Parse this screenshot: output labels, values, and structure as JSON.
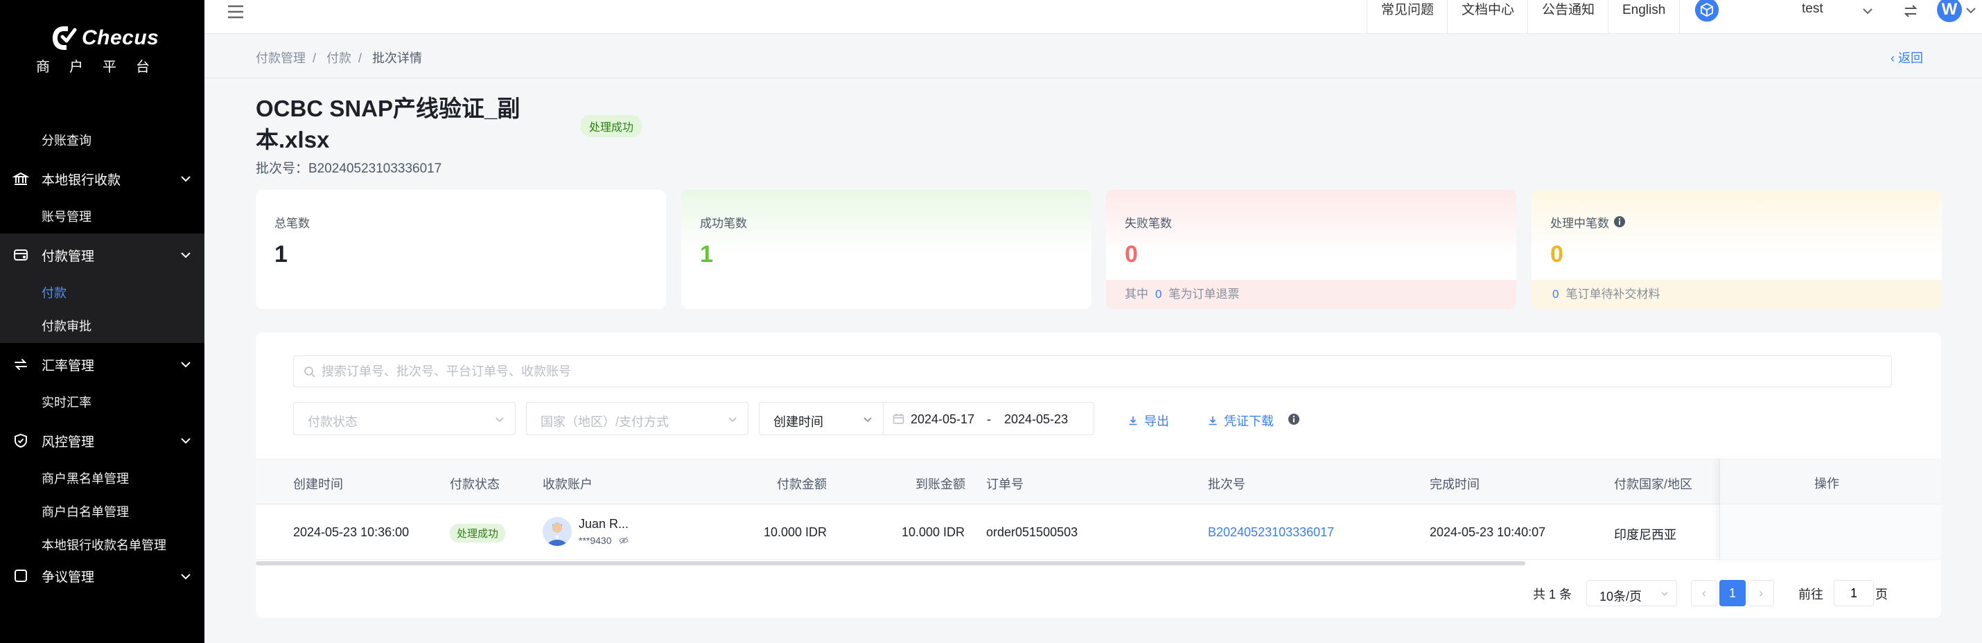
{
  "sidebar": {
    "logo_text": "Checus",
    "logo_sub": "商户平台",
    "partial_item": "",
    "items_top": [
      {
        "label": "分账查询"
      }
    ],
    "groups": [
      {
        "label": "本地银行收款",
        "icon": "bank-icon",
        "items": [
          {
            "label": "账号管理"
          }
        ]
      },
      {
        "label": "付款管理",
        "icon": "payment-icon",
        "items": [
          {
            "label": "付款",
            "active": true
          },
          {
            "label": "付款审批"
          }
        ]
      },
      {
        "label": "汇率管理",
        "icon": "exchange-icon",
        "items": [
          {
            "label": "实时汇率"
          }
        ]
      },
      {
        "label": "风控管理",
        "icon": "shield-icon",
        "items": [
          {
            "label": "商户黑名单管理"
          },
          {
            "label": "商户白名单管理"
          },
          {
            "label": "本地银行收款名单管理"
          }
        ]
      },
      {
        "label": "争议管理",
        "icon": "dispute-icon",
        "items": []
      }
    ]
  },
  "topbar": {
    "links": [
      "常见问题",
      "文档中心",
      "公告通知",
      "English"
    ],
    "user": "test",
    "avatar_letter": "W"
  },
  "breadcrumb": [
    "付款管理",
    "付款",
    "批次详情"
  ],
  "back_label": "返回",
  "page": {
    "title": "OCBC SNAP产线验证_副本.xlsx",
    "status": "处理成功",
    "batch_label": "批次号：B20240523103336017"
  },
  "stats": {
    "total": {
      "label": "总笔数",
      "value": "1"
    },
    "success": {
      "label": "成功笔数",
      "value": "1",
      "color": "#67c23a"
    },
    "fail": {
      "label": "失败笔数",
      "value": "0",
      "color": "#f56c6c",
      "foot_prefix": "其中",
      "foot_count": "0",
      "foot_suffix": "笔为订单退票"
    },
    "pending": {
      "label": "处理中笔数",
      "value": "0",
      "color": "#f0b429",
      "foot_count": "0",
      "foot_suffix": "笔订单待补交材料"
    }
  },
  "filters": {
    "search_placeholder": "搜索订单号、批次号、平台订单号、收款账号",
    "status_placeholder": "付款状态",
    "country_placeholder": "国家（地区）/支付方式",
    "time_type": "创建时间",
    "date_start": "2024-05-17",
    "date_sep": "-",
    "date_end": "2024-05-23",
    "export_label": "导出",
    "voucher_label": "凭证下载"
  },
  "table": {
    "headers": [
      "创建时间",
      "付款状态",
      "收款账户",
      "付款金额",
      "到账金额",
      "订单号",
      "批次号",
      "完成时间",
      "付款国家/地区",
      "操作"
    ],
    "rows": [
      {
        "created": "2024-05-23 10:36:00",
        "status": "处理成功",
        "payee_name": "Juan R...",
        "payee_acct": "***9430",
        "pay_amount": "10.000 IDR",
        "recv_amount": "10.000 IDR",
        "order_no": "order051500503",
        "batch_no": "B20240523103336017",
        "completed": "2024-05-23 10:40:07",
        "country": "印度尼西亚"
      }
    ]
  },
  "pagination": {
    "total": "共 1 条",
    "page_size": "10条/页",
    "current": "1",
    "goto_label": "前往",
    "goto_value": "1",
    "goto_suffix": "页"
  },
  "colors": {
    "accent": "#3b7ff2",
    "success": "#67c23a",
    "fail": "#f56c6c",
    "pending": "#f0b429"
  }
}
